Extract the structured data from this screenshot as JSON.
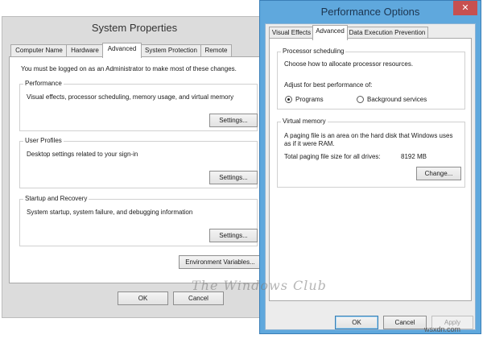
{
  "system_properties": {
    "title": "System Properties",
    "tabs": [
      "Computer Name",
      "Hardware",
      "Advanced",
      "System Protection",
      "Remote"
    ],
    "admin_note": "You must be logged on as an Administrator to make most of these changes.",
    "performance": {
      "label": "Performance",
      "description": "Visual effects, processor scheduling, memory usage, and virtual memory",
      "button": "Settings..."
    },
    "user_profiles": {
      "label": "User Profiles",
      "description": "Desktop settings related to your sign-in",
      "button": "Settings..."
    },
    "startup": {
      "label": "Startup and Recovery",
      "description": "System startup, system failure, and debugging information",
      "button": "Settings..."
    },
    "env_button": "Environment Variables...",
    "ok": "OK",
    "cancel": "Cancel"
  },
  "performance_options": {
    "title": "Performance Options",
    "close": "✕",
    "tabs": [
      "Visual Effects",
      "Advanced",
      "Data Execution Prevention"
    ],
    "processor": {
      "label": "Processor scheduling",
      "description": "Choose how to allocate processor resources.",
      "adjust": "Adjust for best performance of:",
      "options": [
        "Programs",
        "Background services"
      ],
      "selected": "Programs"
    },
    "virtual_memory": {
      "label": "Virtual memory",
      "description_line1": "A paging file is an area on the hard disk that Windows uses",
      "description_line2": "as if it were RAM.",
      "total_label": "Total paging file size for all drives:",
      "total_value": "8192 MB",
      "change_button": "Change..."
    },
    "ok": "OK",
    "cancel": "Cancel",
    "apply": "Apply"
  },
  "watermark": {
    "brand": "The Windows Club",
    "site": "wsxdn.com"
  }
}
